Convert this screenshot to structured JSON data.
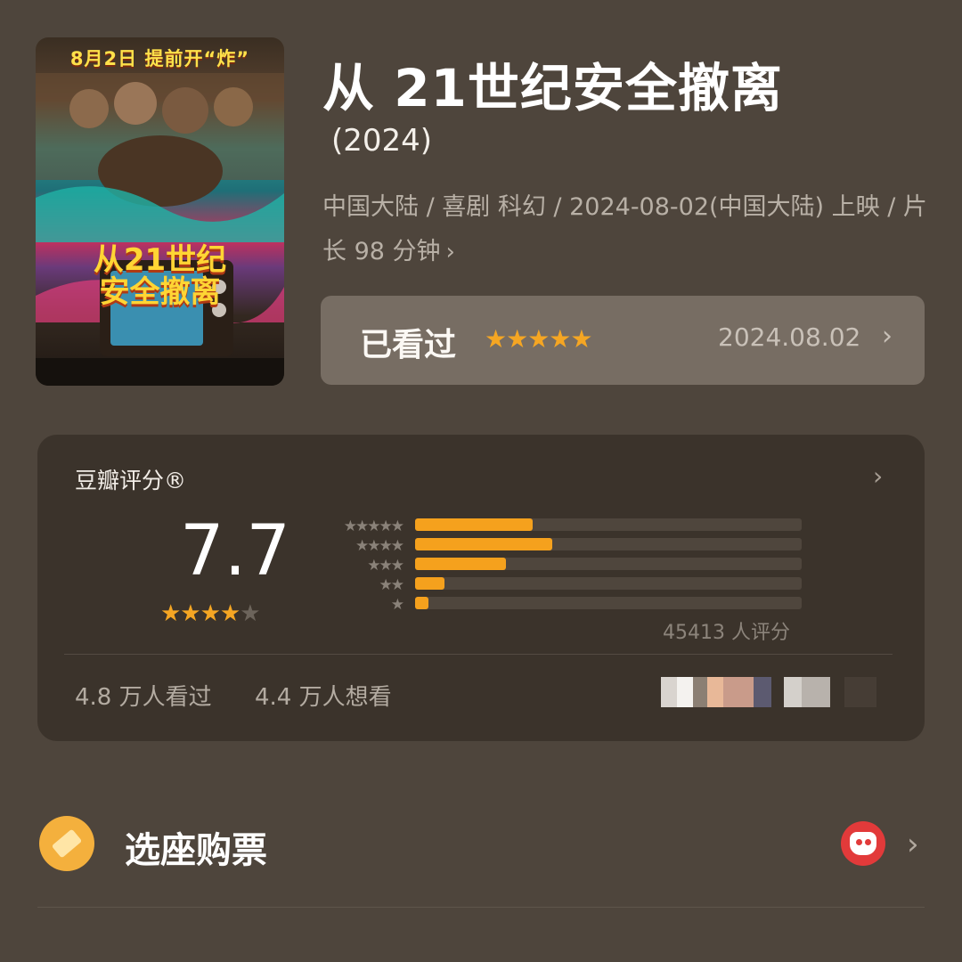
{
  "poster": {
    "date_banner": "8月2日 提前开“炸”",
    "title_line1": "从21世纪",
    "title_line2": "安全撤离"
  },
  "movie": {
    "title": "从 21世纪安全撤离",
    "year": "(2024)",
    "meta": "中国大陆 / 喜剧 科幻 / 2024-08-02(中国大陆) 上映 / 片长 98 分钟"
  },
  "watched": {
    "label": "已看过",
    "stars": "★★★★★",
    "date": "2024.08.02",
    "chevron": "›"
  },
  "rating": {
    "header": "豆瓣评分®",
    "score": "7.7",
    "score_stars_on": "★★★★",
    "score_stars_off": "★",
    "distribution": [
      {
        "stars": "★★★★★",
        "fraction": 0.305
      },
      {
        "stars": "★★★★",
        "fraction": 0.355
      },
      {
        "stars": "★★★",
        "fraction": 0.235
      },
      {
        "stars": "★★",
        "fraction": 0.075
      },
      {
        "stars": "★",
        "fraction": 0.035
      }
    ],
    "count_text": "45413 人评分",
    "seen_text": "4.8 万人看过",
    "want_text": "4.4 万人想看"
  },
  "ticket": {
    "label": "选座购票",
    "chevron": "›"
  },
  "colors": {
    "background": "#4e453c",
    "accent_star": "#f5a623",
    "bar": "#f5a11d",
    "panel": "#3b332b"
  }
}
